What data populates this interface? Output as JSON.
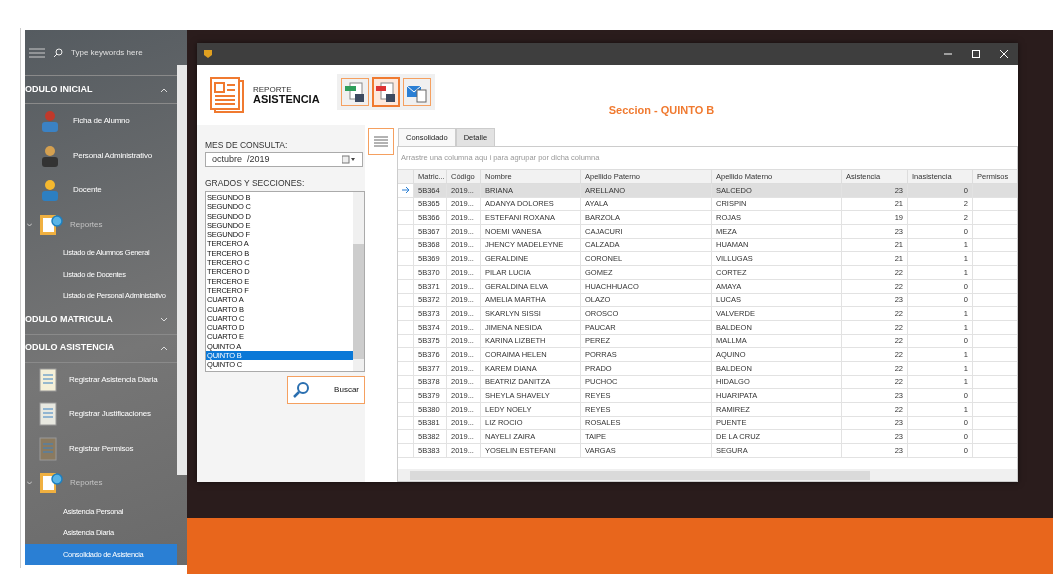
{
  "sidebar": {
    "search": {
      "placeholder": "Type keywords here"
    },
    "sections": [
      {
        "title": "ODULO INICIAL",
        "expanded": true,
        "items": [
          {
            "kind": "entry",
            "label": "Ficha de Alumno"
          },
          {
            "kind": "entry",
            "label": "Personal Administrativo"
          },
          {
            "kind": "entry",
            "label": "Docente"
          },
          {
            "kind": "group",
            "label": "Reportes",
            "expanded": true,
            "children": [
              {
                "label": "Listado de Alumnos General",
                "selected": false
              },
              {
                "label": "Listado de Docentes",
                "selected": false
              },
              {
                "label": "Listado de Personal Administativo",
                "selected": false
              }
            ]
          }
        ]
      },
      {
        "title": "ODULO MATRICULA",
        "expanded": false
      },
      {
        "title": "ODULO ASISTENCIA",
        "expanded": true,
        "items": [
          {
            "kind": "entry",
            "label": "Registrar Asistencia Diaria"
          },
          {
            "kind": "entry",
            "label": "Registrar Justificaciones"
          },
          {
            "kind": "entry",
            "label": "Registrar Permisos"
          },
          {
            "kind": "group",
            "label": "Reportes",
            "expanded": true,
            "children": [
              {
                "label": "Asistencia Personal",
                "selected": false
              },
              {
                "label": "Asistencia Diaria",
                "selected": false
              },
              {
                "label": "Consolidado de Asistencia",
                "selected": true
              }
            ]
          }
        ]
      }
    ]
  },
  "window": {
    "header": {
      "title_small": "REPORTE",
      "title_big": "ASISTENCIA"
    },
    "section_title": "Seccion - QUINTO B",
    "filters": {
      "month_label": "MES DE CONSULTA:",
      "month_value": "octubre  /2019",
      "sections_label": "GRADOS Y SECCIONES:",
      "sections": [
        {
          "label": "SEGUNDO B",
          "selected": false
        },
        {
          "label": "SEGUNDO C",
          "selected": false
        },
        {
          "label": "SEGUNDO D",
          "selected": false
        },
        {
          "label": "SEGUNDO E",
          "selected": false
        },
        {
          "label": "SEGUNDO F",
          "selected": false
        },
        {
          "label": "TERCERO A",
          "selected": false
        },
        {
          "label": "TERCERO B",
          "selected": false
        },
        {
          "label": "TERCERO C",
          "selected": false
        },
        {
          "label": "TERCERO D",
          "selected": false
        },
        {
          "label": "TERCERO E",
          "selected": false
        },
        {
          "label": "TERCERO F",
          "selected": false
        },
        {
          "label": "CUARTO A",
          "selected": false
        },
        {
          "label": "CUARTO B",
          "selected": false
        },
        {
          "label": "CUARTO C",
          "selected": false
        },
        {
          "label": "CUARTO D",
          "selected": false
        },
        {
          "label": "CUARTO E",
          "selected": false
        },
        {
          "label": "QUINTO A",
          "selected": false
        },
        {
          "label": "QUINTO B",
          "selected": true
        },
        {
          "label": "QUINTO C",
          "selected": false
        }
      ],
      "search_button": "Buscar"
    },
    "tabs": [
      {
        "label": "Consolidado",
        "selected": true
      },
      {
        "label": "Detalle",
        "selected": false
      }
    ],
    "grid": {
      "group_hint": "Arrastre una columna aqu i para agrupar por dicha columna",
      "columns": [
        "Matric...",
        "Código",
        "Nombre",
        "Apellido Paterno",
        "Apellido Materno",
        "Asistencia",
        "Inasistencia",
        "Permisos"
      ],
      "rows": [
        {
          "current": true,
          "cells": [
            "5B364",
            "2019...",
            "BRIANA",
            "ARELLANO",
            "SALCEDO",
            "23",
            "0"
          ]
        },
        {
          "current": false,
          "cells": [
            "5B365",
            "2019...",
            "ADANYA DOLORES",
            "AYALA",
            "CRISPIN",
            "21",
            "2"
          ]
        },
        {
          "current": false,
          "cells": [
            "5B366",
            "2019...",
            "ESTEFANI ROXANA",
            "BARZOLA",
            "ROJAS",
            "19",
            "2"
          ]
        },
        {
          "current": false,
          "cells": [
            "5B367",
            "2019...",
            "NOEMI VANESA",
            "CAJACURI",
            "MEZA",
            "23",
            "0"
          ]
        },
        {
          "current": false,
          "cells": [
            "5B368",
            "2019...",
            "JHENCY MADELEYNE",
            "CALZADA",
            "HUAMAN",
            "21",
            "1"
          ]
        },
        {
          "current": false,
          "cells": [
            "5B369",
            "2019...",
            "GERALDINE",
            "CORONEL",
            "VILLUGAS",
            "21",
            "1"
          ]
        },
        {
          "current": false,
          "cells": [
            "5B370",
            "2019...",
            "PILAR LUCIA",
            "GOMEZ",
            "CORTEZ",
            "22",
            "1"
          ]
        },
        {
          "current": false,
          "cells": [
            "5B371",
            "2019...",
            "GERALDINA ELVA",
            "HUACHHUACO",
            "AMAYA",
            "22",
            "0"
          ]
        },
        {
          "current": false,
          "cells": [
            "5B372",
            "2019...",
            "AMELIA MARTHA",
            "OLAZO",
            "LUCAS",
            "23",
            "0"
          ]
        },
        {
          "current": false,
          "cells": [
            "5B373",
            "2019...",
            "SKARLYN SISSI",
            "OROSCO",
            "VALVERDE",
            "22",
            "1"
          ]
        },
        {
          "current": false,
          "cells": [
            "5B374",
            "2019...",
            "JIMENA NESIDA",
            "PAUCAR",
            "BALDEON",
            "22",
            "1"
          ]
        },
        {
          "current": false,
          "cells": [
            "5B375",
            "2019...",
            "KARINA LIZBETH",
            "PEREZ",
            "MALLMA",
            "22",
            "0"
          ]
        },
        {
          "current": false,
          "cells": [
            "5B376",
            "2019...",
            "CORAIMA HELEN",
            "PORRAS",
            "AQUINO",
            "22",
            "1"
          ]
        },
        {
          "current": false,
          "cells": [
            "5B377",
            "2019...",
            "KAREM DIANA",
            "PRADO",
            "BALDEON",
            "22",
            "1"
          ]
        },
        {
          "current": false,
          "cells": [
            "5B378",
            "2019...",
            "BEATRIZ DANITZA",
            "PUCHOC",
            "HIDALGO",
            "22",
            "1"
          ]
        },
        {
          "current": false,
          "cells": [
            "5B379",
            "2019...",
            "SHEYLA SHAVELY",
            "REYES",
            "HUARIPATA",
            "23",
            "0"
          ]
        },
        {
          "current": false,
          "cells": [
            "5B380",
            "2019...",
            "LEDY NOELY",
            "REYES",
            "RAMIREZ",
            "22",
            "1"
          ]
        },
        {
          "current": false,
          "cells": [
            "5B381",
            "2019...",
            "LIZ ROCIO",
            "ROSALES",
            "PUENTE",
            "23",
            "0"
          ]
        },
        {
          "current": false,
          "cells": [
            "5B382",
            "2019...",
            "NAYELI ZAIRA",
            "TAIPE",
            "DE LA CRUZ",
            "23",
            "0"
          ]
        },
        {
          "current": false,
          "cells": [
            "5B383",
            "2019...",
            "YOSELIN ESTEFANI",
            "VARGAS",
            "SEGURA",
            "23",
            "0"
          ]
        }
      ]
    }
  }
}
